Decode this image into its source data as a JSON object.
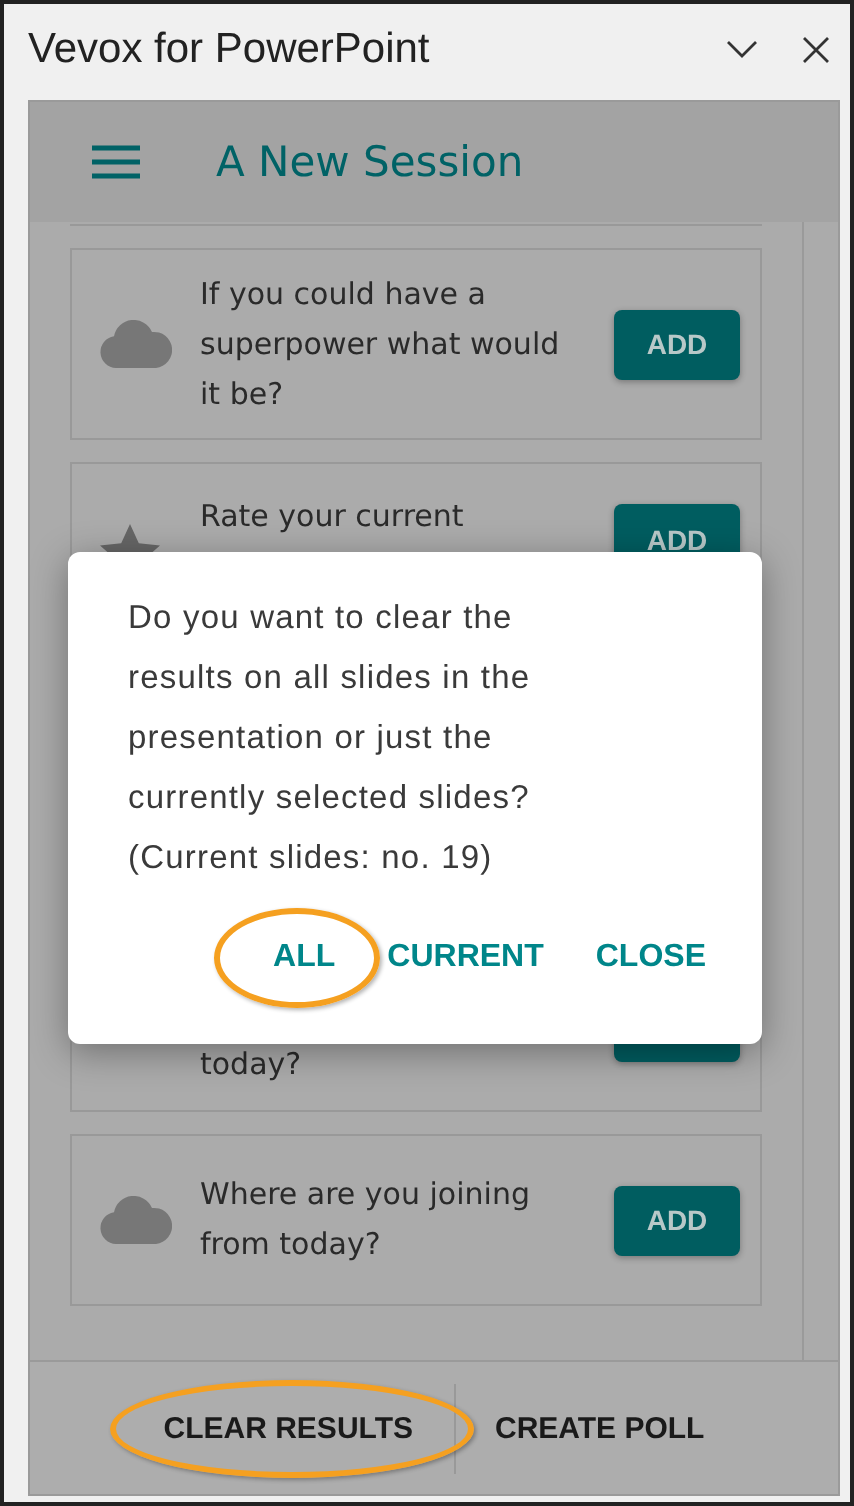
{
  "window": {
    "title": "Vevox for PowerPoint"
  },
  "header": {
    "title": "A New Session"
  },
  "cards": [
    {
      "kind": "cloud",
      "text": "If you could have a superpower what would it be?",
      "button": "ADD",
      "clipped": false
    },
    {
      "kind": "star",
      "text": "Rate your current",
      "button": "ADD",
      "clipped": true
    },
    {
      "kind": "hidden",
      "text": "today?",
      "clipped": true
    },
    {
      "kind": "cloud",
      "text": "Where are you joining from today?",
      "button": "ADD",
      "clipped": false
    }
  ],
  "dialog": {
    "message": "Do you want to clear the results on all slides in the presentation or just the currently selected slides? (Current slides: no. 19)",
    "buttons": [
      {
        "label": "ALL",
        "highlighted": true
      },
      {
        "label": "CURRENT",
        "highlighted": false
      },
      {
        "label": "CLOSE",
        "highlighted": false
      }
    ]
  },
  "footer": {
    "buttons": [
      {
        "label": "CLEAR RESULTS",
        "highlighted": true
      },
      {
        "label": "CREATE POLL",
        "highlighted": false
      }
    ]
  }
}
